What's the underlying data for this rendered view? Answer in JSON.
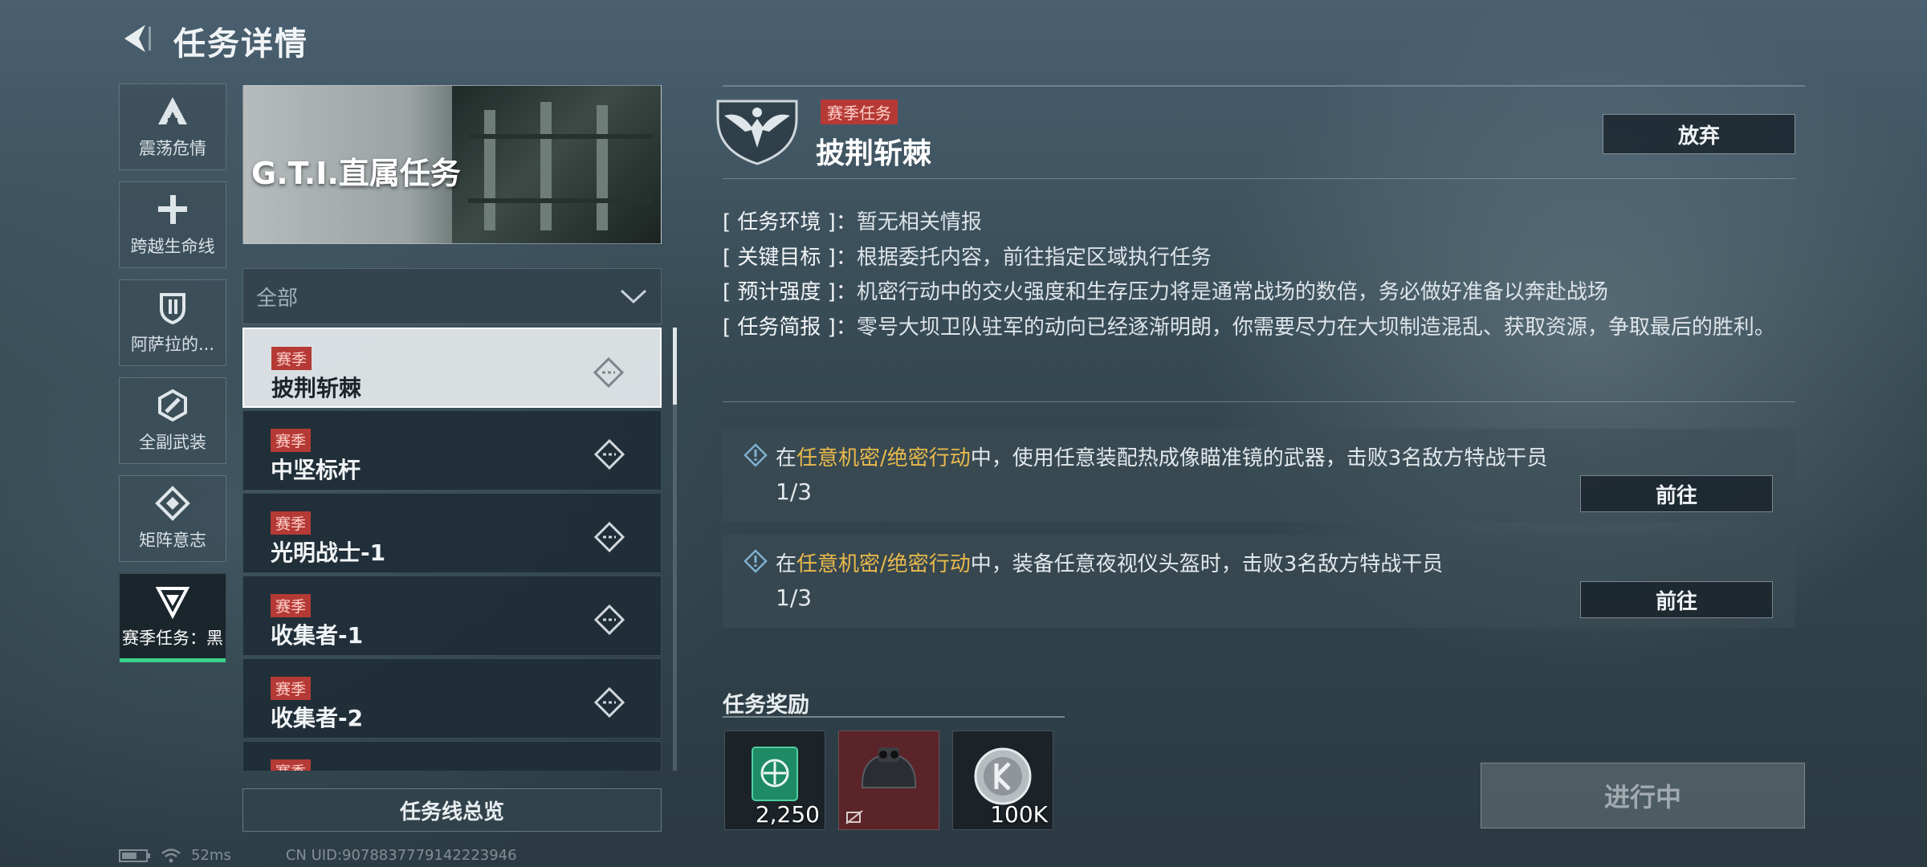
{
  "header": {
    "title": "任务详情"
  },
  "categories": [
    {
      "label": "震荡危情",
      "icon": "triangle-a-icon"
    },
    {
      "label": "跨越生命线",
      "icon": "cross-icon"
    },
    {
      "label": "阿萨拉的...",
      "icon": "shield-icon"
    },
    {
      "label": "全副武装",
      "icon": "hexagon-slash-icon"
    },
    {
      "label": "矩阵意志",
      "icon": "diamond-icon"
    },
    {
      "label": "赛季任务：黑",
      "icon": "funnel-triangle-icon",
      "active": true
    }
  ],
  "banner": {
    "title": "G.T.I.直属任务"
  },
  "filter": {
    "value": "全部"
  },
  "missions": [
    {
      "tag": "赛季",
      "name": "披荆斩棘",
      "active": true
    },
    {
      "tag": "赛季",
      "name": "中坚标杆"
    },
    {
      "tag": "赛季",
      "name": "光明战士-1"
    },
    {
      "tag": "赛季",
      "name": "收集者-1"
    },
    {
      "tag": "赛季",
      "name": "收集者-2"
    },
    {
      "tag": "赛季",
      "name": ""
    }
  ],
  "overview_label": "任务线总览",
  "status": {
    "ping": "52ms",
    "uid": "CN UID:9078837779142223946"
  },
  "detail": {
    "season_tag": "赛季任务",
    "title": "披荆斩棘",
    "abandon_label": "放弃",
    "info": [
      {
        "key": "[ 任务环境 ]：",
        "value": "暂无相关情报"
      },
      {
        "key": "[ 关键目标 ]：",
        "value": "根据委托内容，前往指定区域执行任务"
      },
      {
        "key": "[ 预计强度 ]：",
        "value": "机密行动中的交火强度和生存压力将是通常战场的数倍，务必做好准备以奔赴战场"
      },
      {
        "key": "[ 任务简报 ]：",
        "value": "零号大坝卫队驻军的动向已经逐渐明朗，你需要尽力在大坝制造混乱、获取资源，争取最后的胜利。"
      }
    ],
    "objectives": [
      {
        "pre": "在",
        "highlight": "任意机密/绝密行动",
        "post": "中，使用任意装配热成像瞄准镜的武器，击败3名敌方特战干员",
        "progress": "1/3",
        "go_label": "前往"
      },
      {
        "pre": "在",
        "highlight": "任意机密/绝密行动",
        "post": "中，装备任意夜视仪头盔时，击败3名敌方特战干员",
        "progress": "1/3",
        "go_label": "前往"
      }
    ],
    "reward_title": "任务奖励",
    "rewards": [
      {
        "amount": "2,250",
        "icon": "emblem-card-icon"
      },
      {
        "amount": "",
        "icon": "night-vision-helmet-icon"
      },
      {
        "amount": "100K",
        "icon": "silver-coin-icon"
      }
    ],
    "status_label": "进行中"
  },
  "colors": {
    "accent": "#3ad28a",
    "highlight": "#e9b94b",
    "tag": "#b53a35"
  }
}
